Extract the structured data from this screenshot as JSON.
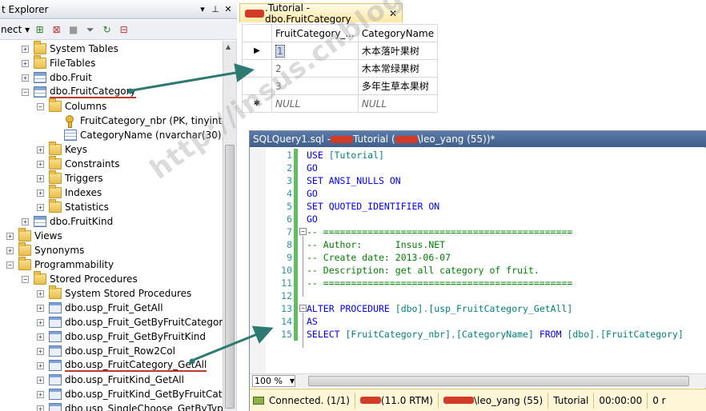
{
  "object_explorer": {
    "title": "t Explorer",
    "connect_label": "nect",
    "tree": [
      {
        "label": "System Tables",
        "icon": "folder-icon",
        "expander": "+",
        "indent": 1
      },
      {
        "label": "FileTables",
        "icon": "folder-icon",
        "expander": "+",
        "indent": 1
      },
      {
        "label": "dbo.Fruit",
        "icon": "table-icon",
        "expander": "+",
        "indent": 1
      },
      {
        "label": "dbo.FruitCategory",
        "icon": "table-icon",
        "expander": "−",
        "indent": 1
      },
      {
        "label": "Columns",
        "icon": "folder-icon",
        "expander": "−",
        "indent": 2
      },
      {
        "label": "FruitCategory_nbr (PK, tinyint, no",
        "icon": "key-icon",
        "expander": "",
        "indent": 3
      },
      {
        "label": "CategoryName (nvarchar(30), not",
        "icon": "column-icon",
        "expander": "",
        "indent": 3
      },
      {
        "label": "Keys",
        "icon": "folder-icon",
        "expander": "+",
        "indent": 2
      },
      {
        "label": "Constraints",
        "icon": "folder-icon",
        "expander": "+",
        "indent": 2
      },
      {
        "label": "Triggers",
        "icon": "folder-icon",
        "expander": "+",
        "indent": 2
      },
      {
        "label": "Indexes",
        "icon": "folder-icon",
        "expander": "+",
        "indent": 2
      },
      {
        "label": "Statistics",
        "icon": "folder-icon",
        "expander": "+",
        "indent": 2
      },
      {
        "label": "dbo.FruitKind",
        "icon": "table-icon",
        "expander": "+",
        "indent": 1
      },
      {
        "label": "Views",
        "icon": "folder-icon",
        "expander": "+",
        "indent": 0
      },
      {
        "label": "Synonyms",
        "icon": "folder-icon",
        "expander": "+",
        "indent": 0
      },
      {
        "label": "Programmability",
        "icon": "folder-icon",
        "expander": "−",
        "indent": 0
      },
      {
        "label": "Stored Procedures",
        "icon": "folder-icon",
        "expander": "−",
        "indent": 1
      },
      {
        "label": "System Stored Procedures",
        "icon": "folder-icon",
        "expander": "+",
        "indent": 2
      },
      {
        "label": "dbo.usp_Fruit_GetAll",
        "icon": "procedure-icon",
        "expander": "+",
        "indent": 2
      },
      {
        "label": "dbo.usp_Fruit_GetByFruitCategory",
        "icon": "procedure-icon",
        "expander": "+",
        "indent": 2
      },
      {
        "label": "dbo.usp_Fruit_GetByFruitKind",
        "icon": "procedure-icon",
        "expander": "+",
        "indent": 2
      },
      {
        "label": "dbo.usp_Fruit_Row2Col",
        "icon": "procedure-icon",
        "expander": "+",
        "indent": 2
      },
      {
        "label": "dbo.usp_FruitCategory_GetAll",
        "icon": "procedure-icon",
        "expander": "+",
        "indent": 2
      },
      {
        "label": "dbo.usp_FruitKind_GetAll",
        "icon": "procedure-icon",
        "expander": "+",
        "indent": 2
      },
      {
        "label": "dbo.usp_FruitKind_GetByFruitCatego",
        "icon": "procedure-icon",
        "expander": "+",
        "indent": 2
      },
      {
        "label": "dbo.usp_SingleChoose_GetByType",
        "icon": "procedure-icon",
        "expander": "+",
        "indent": 2
      }
    ]
  },
  "results_tab": {
    "title": ".Tutorial - dbo.FruitCategory",
    "columns": [
      "FruitCategory_...",
      "CategoryName"
    ],
    "rows": [
      {
        "marker": "▶",
        "id": "1",
        "name": "木本落叶果树"
      },
      {
        "marker": "",
        "id": "2",
        "name": "木本常绿果树"
      },
      {
        "marker": "",
        "id": "3",
        "name": "多年生草本果树"
      },
      {
        "marker": "✱",
        "id": "NULL",
        "name": "NULL"
      }
    ]
  },
  "query_window": {
    "title_prefix": "SQLQuery1.sql -",
    "title_middle": "Tutorial (",
    "title_suffix": "\\leo_yang (55))*",
    "lines": [
      {
        "n": "1",
        "parts": [
          [
            "kw",
            "USE "
          ],
          [
            "id",
            "[Tutorial]"
          ]
        ]
      },
      {
        "n": "2",
        "parts": [
          [
            "kw",
            "GO"
          ]
        ]
      },
      {
        "n": "3",
        "parts": [
          [
            "kw",
            "SET ANSI_NULLS ON"
          ]
        ]
      },
      {
        "n": "4",
        "parts": [
          [
            "kw",
            "GO"
          ]
        ]
      },
      {
        "n": "5",
        "parts": [
          [
            "kw",
            "SET QUOTED_IDENTIFIER ON"
          ]
        ]
      },
      {
        "n": "6",
        "parts": [
          [
            "kw",
            "GO"
          ]
        ]
      },
      {
        "n": "7",
        "parts": [
          [
            "cm",
            "-- ============================================="
          ]
        ]
      },
      {
        "n": "8",
        "parts": [
          [
            "cm",
            "-- Author:      Insus.NET"
          ]
        ]
      },
      {
        "n": "9",
        "parts": [
          [
            "cm",
            "-- Create date: 2013-06-07"
          ]
        ]
      },
      {
        "n": "10",
        "parts": [
          [
            "cm",
            "-- Description: get all category of fruit."
          ]
        ]
      },
      {
        "n": "11",
        "parts": [
          [
            "cm",
            "-- ============================================="
          ]
        ]
      },
      {
        "n": "12",
        "parts": []
      },
      {
        "n": "13",
        "parts": [
          [
            "kw",
            "ALTER PROCEDURE "
          ],
          [
            "id",
            "[dbo]"
          ],
          [
            "gr",
            "."
          ],
          [
            "id",
            "[usp_FruitCategory_GetAll]"
          ]
        ]
      },
      {
        "n": "14",
        "parts": [
          [
            "kw",
            "AS"
          ]
        ]
      },
      {
        "n": "15",
        "parts": [
          [
            "kw",
            "SELECT "
          ],
          [
            "id",
            "[FruitCategory_nbr]"
          ],
          [
            "gr",
            ","
          ],
          [
            "id",
            "[CategoryName]"
          ],
          [
            "kw",
            " FROM "
          ],
          [
            "id",
            "[dbo]"
          ],
          [
            "gr",
            "."
          ],
          [
            "id",
            "[FruitCategory]"
          ]
        ]
      }
    ],
    "zoom": "100 %"
  },
  "status_bar": {
    "connected": "Connected. (1/1)",
    "version": "(11.0 RTM)",
    "user": "\\leo_yang (55)",
    "database": "Tutorial",
    "elapsed": "00:00:00",
    "rows": "0 r"
  },
  "watermark": "http://insus.cnblogs.com",
  "colors": {
    "keyword": "#0000ff",
    "comment": "#008000",
    "identifier": "#008080",
    "arrow": "#2e7a73",
    "underline": "#c0392b"
  }
}
